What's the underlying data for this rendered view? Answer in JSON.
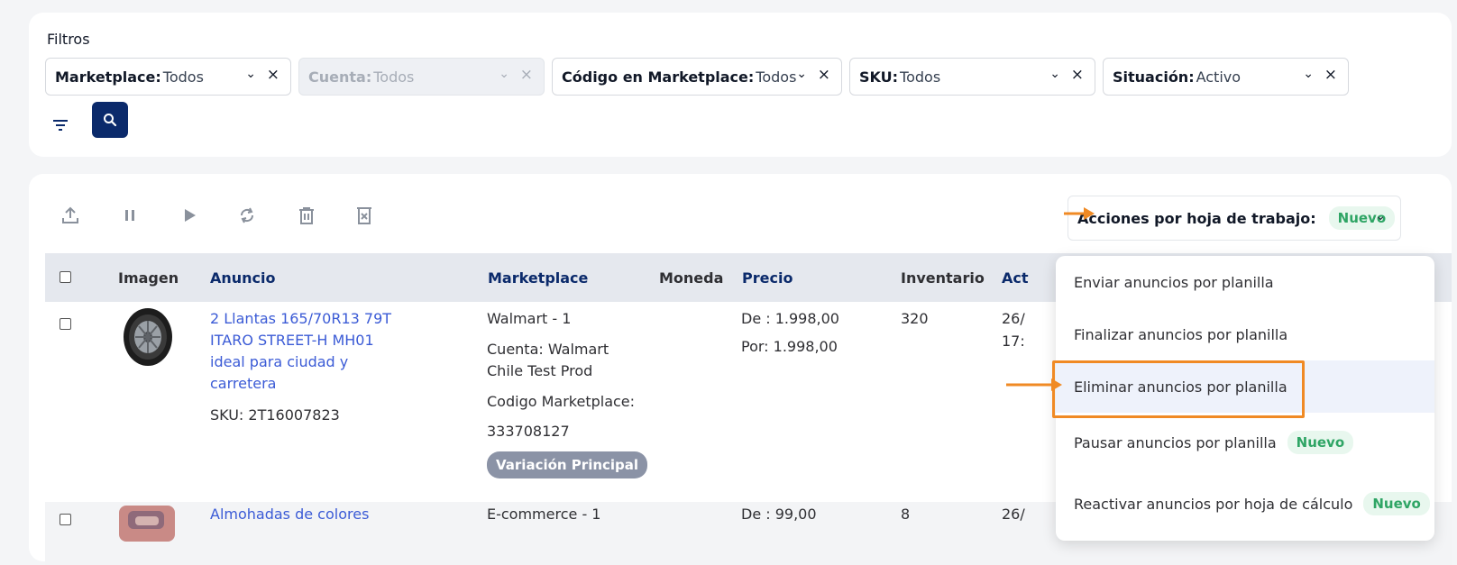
{
  "filters": {
    "title": "Filtros",
    "items": [
      {
        "label": "Marketplace:",
        "value": "Todos"
      },
      {
        "label": "Cuenta:",
        "value": "Todos"
      },
      {
        "label": "Código en Marketplace:",
        "value": "Todos"
      },
      {
        "label": "SKU:",
        "value": "Todos"
      },
      {
        "label": "Situación:",
        "value": "Activo"
      }
    ]
  },
  "toolbar": {
    "icons": [
      "upload-icon",
      "pause-icon",
      "play-icon",
      "sync-icon",
      "trash-icon",
      "delete-box-icon"
    ]
  },
  "bulk": {
    "label": "Acciones por hoja de trabajo:",
    "badge": "Nuevo"
  },
  "table": {
    "headers": [
      "Imagen",
      "Anuncio",
      "Marketplace",
      "Moneda",
      "Precio",
      "Inventario",
      "Act"
    ],
    "rows": [
      {
        "title_lines": [
          "2 Llantas 165/70R13 79T",
          "ITARO STREET-H MH01",
          "ideal para ciudad y",
          "carretera"
        ],
        "sku": "SKU: 2T16007823",
        "marketplace": "Walmart - 1",
        "account_lines": [
          "Cuenta: Walmart",
          "Chile Test Prod"
        ],
        "code_label": "Codigo Marketplace:",
        "code_value": "333708127",
        "variation": "Variación Principal",
        "price_de": "De : 1.998,00",
        "price_por": "Por: 1.998,00",
        "inventory": "320",
        "date_fragment_1": "26/",
        "date_fragment_2": "17:"
      },
      {
        "title": "Almohadas de colores",
        "marketplace": "E-commerce - 1",
        "price_de": "De : 99,00",
        "inventory": "8",
        "date_fragment": "26/"
      }
    ]
  },
  "dropdown": {
    "items": [
      {
        "label": "Enviar anuncios por planilla",
        "badge": ""
      },
      {
        "label": "Finalizar anuncios por planilla",
        "badge": ""
      },
      {
        "label": "Eliminar anuncios por planilla",
        "badge": ""
      },
      {
        "label": "Pausar anuncios por planilla",
        "badge": "Nuevo"
      },
      {
        "label": "Reactivar anuncios por hoja de cálculo",
        "badge": "Nuevo"
      }
    ]
  },
  "colors": {
    "navy": "#0b2a6b",
    "link": "#3b5bd6",
    "badge_green": "#2fa565",
    "annotation_orange": "#f08a24"
  }
}
